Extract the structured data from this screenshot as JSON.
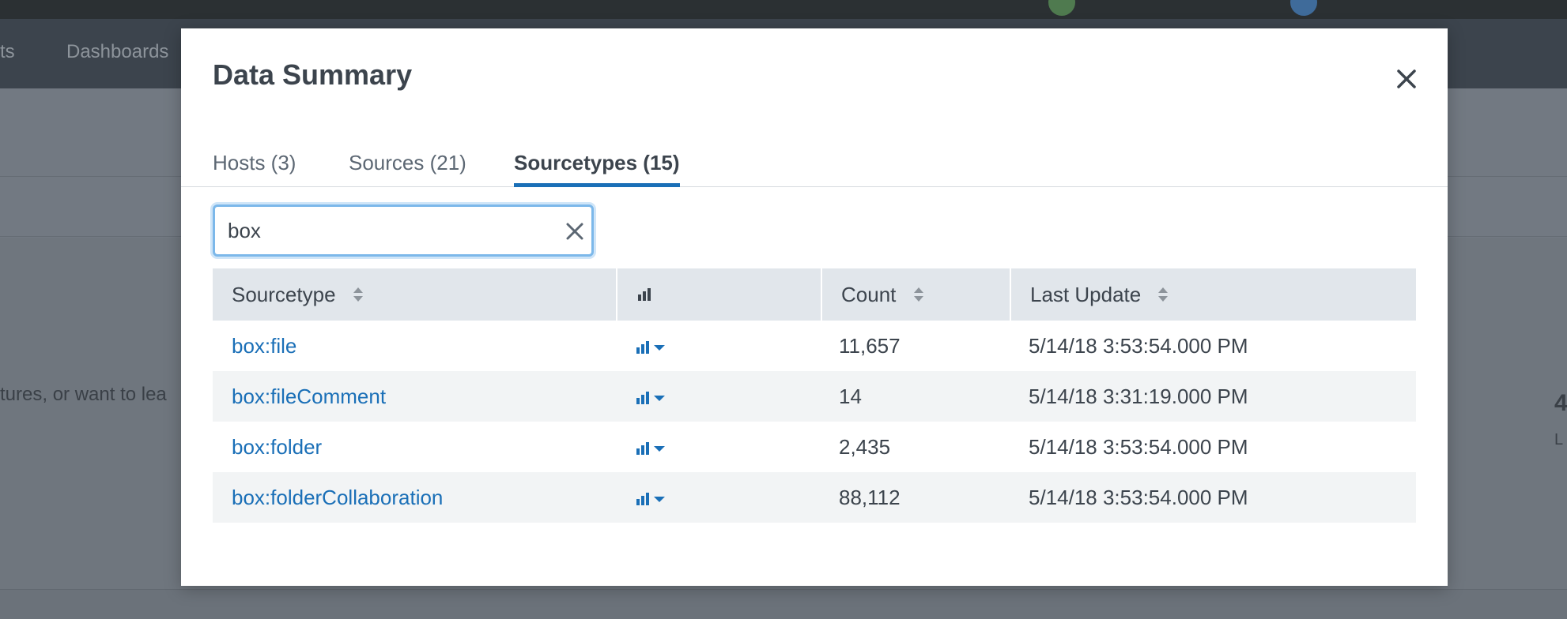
{
  "background": {
    "nav_items": [
      "ts",
      "Dashboards"
    ],
    "partial_text": "tures, or want to lea"
  },
  "modal": {
    "title": "Data Summary",
    "close_icon": "close-icon",
    "tabs": [
      {
        "label": "Hosts (3)",
        "active": false
      },
      {
        "label": "Sources (21)",
        "active": false
      },
      {
        "label": "Sourcetypes (15)",
        "active": true
      }
    ],
    "search": {
      "value": "box",
      "clear_icon": "clear-icon"
    },
    "table": {
      "columns": [
        "Sourcetype",
        "",
        "Count",
        "Last Update"
      ],
      "chart_icon": "bar-chart-icon",
      "rows": [
        {
          "sourcetype": "box:file",
          "count": "11,657",
          "last_update": "5/14/18 3:53:54.000 PM"
        },
        {
          "sourcetype": "box:fileComment",
          "count": "14",
          "last_update": "5/14/18 3:31:19.000 PM"
        },
        {
          "sourcetype": "box:folder",
          "count": "2,435",
          "last_update": "5/14/18 3:53:54.000 PM"
        },
        {
          "sourcetype": "box:folderCollaboration",
          "count": "88,112",
          "last_update": "5/14/18 3:53:54.000 PM"
        }
      ]
    }
  },
  "colors": {
    "accent": "#1a6fb7",
    "header_bg": "#e1e6eb",
    "overlay": "#727982"
  }
}
